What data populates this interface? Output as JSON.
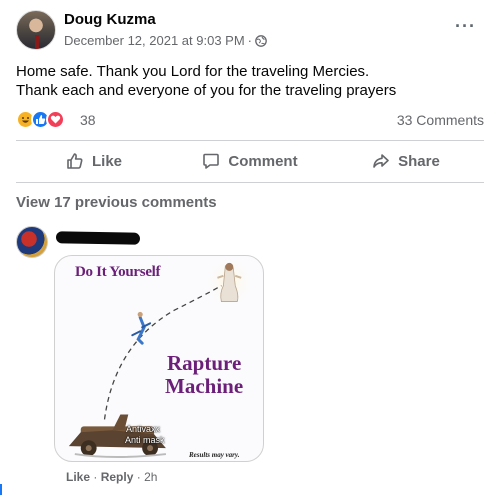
{
  "post": {
    "author": "Doug Kuzma",
    "timestamp": "December 12, 2021 at 9:03 PM",
    "separator": "·",
    "more_icon": "···",
    "text_line1": "Home safe. Thank you Lord for the traveling Mercies.",
    "text_line2": "Thank each and everyone of you for the traveling prayers",
    "reaction_count": "38",
    "comment_count": "33 Comments",
    "reaction_icons": [
      "haha-icon",
      "like-icon",
      "love-icon"
    ]
  },
  "actions": {
    "like": "Like",
    "comment": "Comment",
    "share": "Share"
  },
  "comments": {
    "view_previous": "View 17 previous comments",
    "reply": {
      "author": "",
      "image": {
        "title": "Do It Yourself",
        "heading_line1": "Rapture",
        "heading_line2": "Machine",
        "label_line1": "Antivaxx",
        "label_line2": "Anti mask",
        "footnote": "Results may vary."
      },
      "like_label": "Like",
      "dot": "·",
      "reply_label": "Reply",
      "age": "2h"
    }
  },
  "colors": {
    "meme_purple": "#6b1f79",
    "link_gray": "#65676b",
    "like_blue": "#1877f2",
    "love_red": "#f33e58",
    "haha_yellow": "#f7b125"
  }
}
